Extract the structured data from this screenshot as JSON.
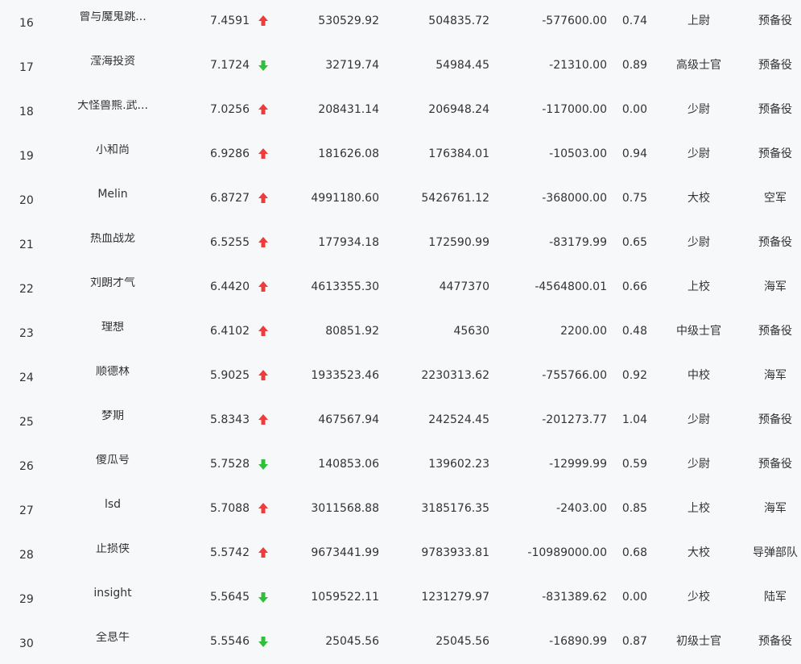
{
  "colors": {
    "up": "#ee3b3b",
    "down": "#2fbf3a",
    "text": "#333333",
    "background": "#f7f8fa"
  },
  "rows": [
    {
      "rank": "16",
      "name": "曾与魔鬼跳...",
      "score": "7.4591",
      "trend": "up",
      "v1": "530529.92",
      "v2": "504835.72",
      "v3": "-577600.00",
      "v4": "0.74",
      "title": "上尉",
      "branch": "预备役"
    },
    {
      "rank": "17",
      "name": "滢海投资",
      "score": "7.1724",
      "trend": "down",
      "v1": "32719.74",
      "v2": "54984.45",
      "v3": "-21310.00",
      "v4": "0.89",
      "title": "高级士官",
      "branch": "预备役"
    },
    {
      "rank": "18",
      "name": "大怪兽熊.武...",
      "score": "7.0256",
      "trend": "up",
      "v1": "208431.14",
      "v2": "206948.24",
      "v3": "-117000.00",
      "v4": "0.00",
      "title": "少尉",
      "branch": "预备役"
    },
    {
      "rank": "19",
      "name": "小和尚",
      "score": "6.9286",
      "trend": "up",
      "v1": "181626.08",
      "v2": "176384.01",
      "v3": "-10503.00",
      "v4": "0.94",
      "title": "少尉",
      "branch": "预备役"
    },
    {
      "rank": "20",
      "name": "Melin",
      "score": "6.8727",
      "trend": "up",
      "v1": "4991180.60",
      "v2": "5426761.12",
      "v3": "-368000.00",
      "v4": "0.75",
      "title": "大校",
      "branch": "空军"
    },
    {
      "rank": "21",
      "name": "热血战龙",
      "score": "6.5255",
      "trend": "up",
      "v1": "177934.18",
      "v2": "172590.99",
      "v3": "-83179.99",
      "v4": "0.65",
      "title": "少尉",
      "branch": "预备役"
    },
    {
      "rank": "22",
      "name": "刘朗才气",
      "score": "6.4420",
      "trend": "up",
      "v1": "4613355.30",
      "v2": "4477370",
      "v3": "-4564800.01",
      "v4": "0.66",
      "title": "上校",
      "branch": "海军"
    },
    {
      "rank": "23",
      "name": "理想",
      "score": "6.4102",
      "trend": "up",
      "v1": "80851.92",
      "v2": "45630",
      "v3": "2200.00",
      "v4": "0.48",
      "title": "中级士官",
      "branch": "预备役"
    },
    {
      "rank": "24",
      "name": "顺德林",
      "score": "5.9025",
      "trend": "up",
      "v1": "1933523.46",
      "v2": "2230313.62",
      "v3": "-755766.00",
      "v4": "0.92",
      "title": "中校",
      "branch": "海军"
    },
    {
      "rank": "25",
      "name": "梦期",
      "score": "5.8343",
      "trend": "up",
      "v1": "467567.94",
      "v2": "242524.45",
      "v3": "-201273.77",
      "v4": "1.04",
      "title": "少尉",
      "branch": "预备役"
    },
    {
      "rank": "26",
      "name": "傻瓜号",
      "score": "5.7528",
      "trend": "down",
      "v1": "140853.06",
      "v2": "139602.23",
      "v3": "-12999.99",
      "v4": "0.59",
      "title": "少尉",
      "branch": "预备役"
    },
    {
      "rank": "27",
      "name": "lsd",
      "score": "5.7088",
      "trend": "up",
      "v1": "3011568.88",
      "v2": "3185176.35",
      "v3": "-2403.00",
      "v4": "0.85",
      "title": "上校",
      "branch": "海军"
    },
    {
      "rank": "28",
      "name": "止损侠",
      "score": "5.5742",
      "trend": "up",
      "v1": "9673441.99",
      "v2": "9783933.81",
      "v3": "-10989000.00",
      "v4": "0.68",
      "title": "大校",
      "branch": "导弹部队"
    },
    {
      "rank": "29",
      "name": "insight",
      "score": "5.5645",
      "trend": "down",
      "v1": "1059522.11",
      "v2": "1231279.97",
      "v3": "-831389.62",
      "v4": "0.00",
      "title": "少校",
      "branch": "陆军"
    },
    {
      "rank": "30",
      "name": "全息牛",
      "score": "5.5546",
      "trend": "down",
      "v1": "25045.56",
      "v2": "25045.56",
      "v3": "-16890.99",
      "v4": "0.87",
      "title": "初级士官",
      "branch": "预备役"
    }
  ]
}
